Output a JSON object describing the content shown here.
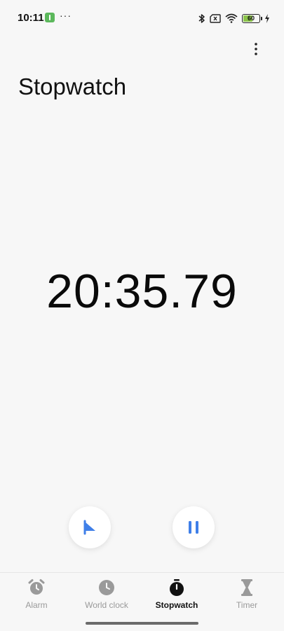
{
  "status_bar": {
    "time": "10:11",
    "more": "···",
    "battery_level": "60",
    "battery_fraction": 0.6
  },
  "header": {
    "title": "Stopwatch",
    "menu_icon": "more-vertical-icon"
  },
  "stopwatch": {
    "elapsed": "20:35.79"
  },
  "controls": {
    "lap_icon": "flag-icon",
    "pause_icon": "pause-icon"
  },
  "bottom_nav": {
    "items": [
      {
        "label": "Alarm",
        "icon": "alarm-clock-icon",
        "active": false
      },
      {
        "label": "World clock",
        "icon": "clock-icon",
        "active": false
      },
      {
        "label": "Stopwatch",
        "icon": "stopwatch-icon",
        "active": true
      },
      {
        "label": "Timer",
        "icon": "hourglass-icon",
        "active": false
      }
    ]
  },
  "colors": {
    "accent": "#3f7fe8",
    "background": "#f7f7f7",
    "inactive": "#9a9a9a",
    "battery": "#8bc34a",
    "app_badge": "#5cb85c"
  }
}
